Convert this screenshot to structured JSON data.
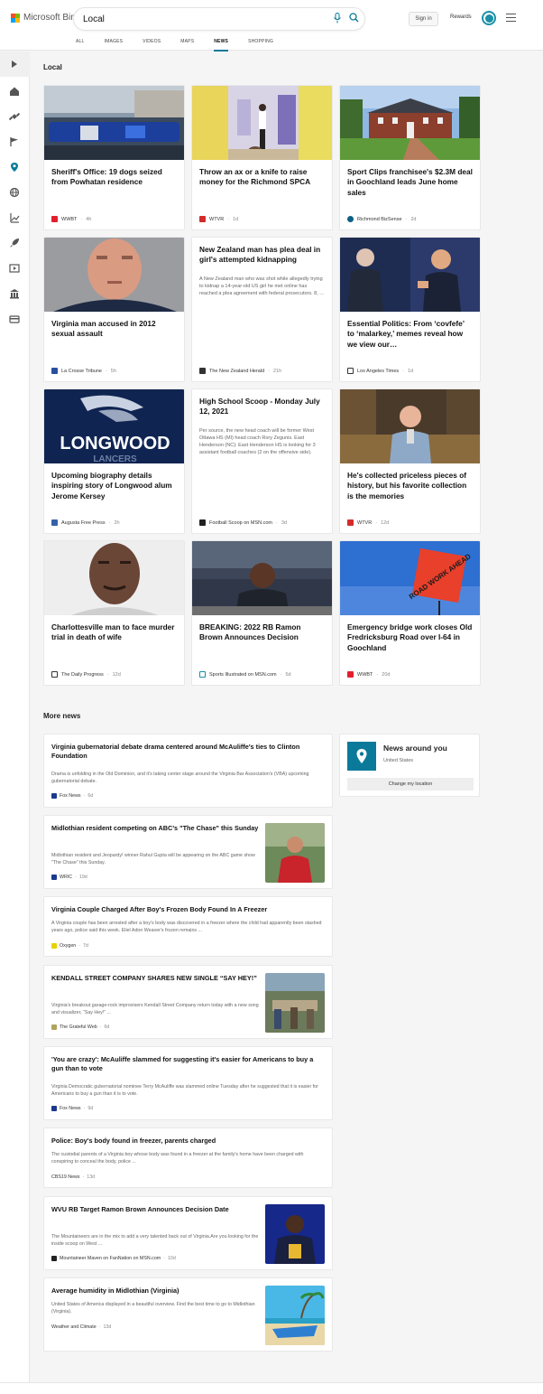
{
  "header": {
    "brand": "Microsoft Bing",
    "query": "Local",
    "signin_label": "Sign in",
    "rewards_label": "Rewards"
  },
  "tabs": [
    {
      "label": "ALL"
    },
    {
      "label": "IMAGES"
    },
    {
      "label": "VIDEOS"
    },
    {
      "label": "MAPS"
    },
    {
      "label": "NEWS"
    },
    {
      "label": "SHOPPING"
    }
  ],
  "active_tab": "NEWS",
  "section_local": "Local",
  "cards": [
    {
      "title": "Sheriff's Office: 19 dogs seized from Powhatan residence",
      "snippet": "",
      "source": "WWBT",
      "age": "4h"
    },
    {
      "title": "Throw an ax or a knife to raise money for the Richmond SPCA",
      "snippet": "",
      "source": "WTVR",
      "age": "1d"
    },
    {
      "title": "Sport Clips franchisee's $2.3M deal in Goochland leads June home sales",
      "snippet": "",
      "source": "Richmond BizSense",
      "age": "2d"
    },
    {
      "title": "Virginia man accused in 2012 sexual assault",
      "snippet": "",
      "source": "La Crosse Tribune",
      "age": "5h"
    },
    {
      "title": "New Zealand man has plea deal in girl's attempted kidnapping",
      "snippet": "A New Zealand man who was shot while allegedly trying to kidnap a 14-year-old US girl he met online has reached a plea agreement with federal prosecutors. 8, ...",
      "source": "The New Zealand Herald",
      "age": "21h"
    },
    {
      "title": "Essential Politics: From ‘covfefe’ to ‘malarkey,’ memes reveal how we view our…",
      "snippet": "",
      "source": "Los Angeles Times",
      "age": "1d"
    },
    {
      "title": "Upcoming biography details inspiring story of Longwood alum Jerome Kersey",
      "snippet": "",
      "source": "Augusta Free Press",
      "age": "2h"
    },
    {
      "title": "High School Scoop - Monday July 12, 2021",
      "snippet": "Per source, the new head coach will be former West Ottawa HS (MI) head coach Rory Zegunis. East Henderson (NC): East Henderson HS is looking for 3 assistant football coaches (2 on the offensive side).",
      "source": "Football Scoop on MSN.com",
      "age": "3d"
    },
    {
      "title": "He's collected priceless pieces of history, but his favorite collection is the memories",
      "snippet": "",
      "source": "WTVR",
      "age": "12d"
    },
    {
      "title": "Charlottesville man to face murder trial in death of wife",
      "snippet": "",
      "source": "The Daily Progress",
      "age": "12d"
    },
    {
      "title": "BREAKING: 2022 RB Ramon Brown Announces Decision",
      "snippet": "",
      "source": "Sports Illustrated on MSN.com",
      "age": "5d"
    },
    {
      "title": "Emergency bridge work closes Old Fredricksburg Road over I-64 in Goochland",
      "snippet": "",
      "source": "WWBT",
      "age": "20d"
    }
  ],
  "image_text": {
    "longwood": "LONGWOOD",
    "lancers": "LANCERS",
    "road_sign": "ROAD WORK AHEAD"
  },
  "section_more": "More news",
  "more_news": [
    {
      "title": "Virginia gubernatorial debate drama centered around McAuliffe's ties to Clinton Foundation",
      "snippet": "Drama is unfolding in the Old Dominion, and it's taking center stage around the Virginia Bar Association's (VBA) upcoming gubernatorial debate.",
      "source": "Fox News",
      "age": "6d"
    },
    {
      "title": "Midlothian resident competing on ABC's \"The Chase\" this Sunday",
      "snippet": "Midlothian resident and Jeopardy! winner Rahul Gupta will be appearing on the ABC game show \"The Chase\" this Sunday.",
      "source": "WRIC",
      "age": "19d"
    },
    {
      "title": "Virginia Couple Charged After Boy's Frozen Body Found In A Freezer",
      "snippet": "A Virginia couple has been arrested after a boy's body was discovered in a freezer where the child had apparently been stashed years ago, police said this week.  Eliel Adon Weaver's frozen remains ...",
      "source": "Oxygen",
      "age": "7d"
    },
    {
      "title": "KENDALL STREET COMPANY SHARES NEW SINGLE “SAY HEY!”",
      "snippet": "Virginia's breakout garage-rock improvisers Kendall Street Company return today with a new song and visualizer, “Say Hey!” ...",
      "source": "The Grateful Web",
      "age": "6d"
    },
    {
      "title": "'You are crazy': McAuliffe slammed for suggesting it's easier for Americans to buy a gun than to vote",
      "snippet": "Virginia Democratic gubernatorial nominee Terry McAuliffe was slammed online Tuesday after he suggested that it is easier for Americans to buy a gun than it is to vote.",
      "source": "Fox News",
      "age": "9d"
    },
    {
      "title": "Police: Boy's body found in freezer, parents charged",
      "snippet": "The custodial parents of a Virginia boy whose body was found in a freezer at the family's home have been charged with conspiring to conceal the body, police ...",
      "source": "CBS19 News",
      "age": "13d"
    },
    {
      "title": "WVU RB Target Ramon Brown Announces Decision Date",
      "snippet": "The Mountaineers are in the mix to add a very talented back out of Virginia.Are you looking for the inside scoop on West ...",
      "source": "Mountaineer Maven on FanNation on MSN.com",
      "age": "10d"
    },
    {
      "title": "Average humidity in Midlothian (Virginia)",
      "snippet": "United States of America displayed in a beautiful overview. Find the best time to go to Midlothian (Virginia).",
      "source": "Weather and Climate",
      "age": "13d"
    }
  ],
  "news_around": {
    "title": "News around you",
    "location": "United States",
    "button_label": "Change my location"
  },
  "colors": {
    "accent": "#0b7a9a",
    "brand_red": "#f25022",
    "brand_green": "#7fba00",
    "brand_blue": "#00a4ef",
    "brand_yellow": "#ffb900"
  }
}
